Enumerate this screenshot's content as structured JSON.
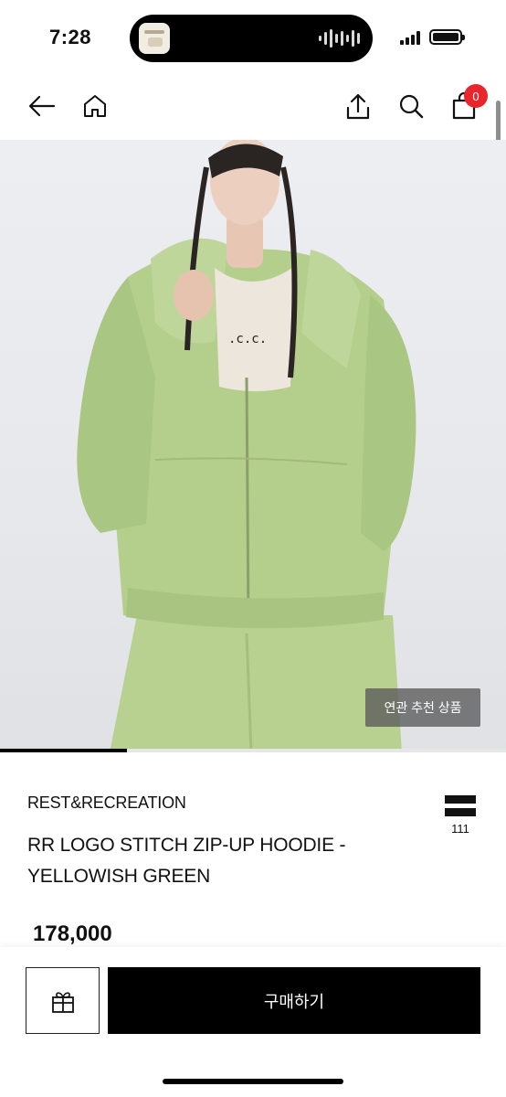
{
  "status_bar": {
    "time": "7:28"
  },
  "nav": {
    "cart_count": "0"
  },
  "hero": {
    "related_label": "연관 추천 상품",
    "image_progress": 0.25,
    "alt": "Model wearing yellowish green zip-up hoodie"
  },
  "product": {
    "brand": "REST&RECREATION",
    "name": "RR LOGO STITCH ZIP-UP HOODIE - YELLOWISH GREEN",
    "price": "178,000",
    "wish_count": "111"
  },
  "actions": {
    "buy_label": "구매하기"
  },
  "colors": {
    "accent_badge": "#e8262b",
    "primary_button": "#000000",
    "hoodie_green": "#b4cf8c"
  },
  "icons": {
    "back": "arrow-left-icon",
    "home": "home-icon",
    "share": "share-icon",
    "search": "search-icon",
    "cart": "shopping-bag-icon",
    "wish": "hamburger-wish-icon",
    "gift": "gift-icon"
  }
}
